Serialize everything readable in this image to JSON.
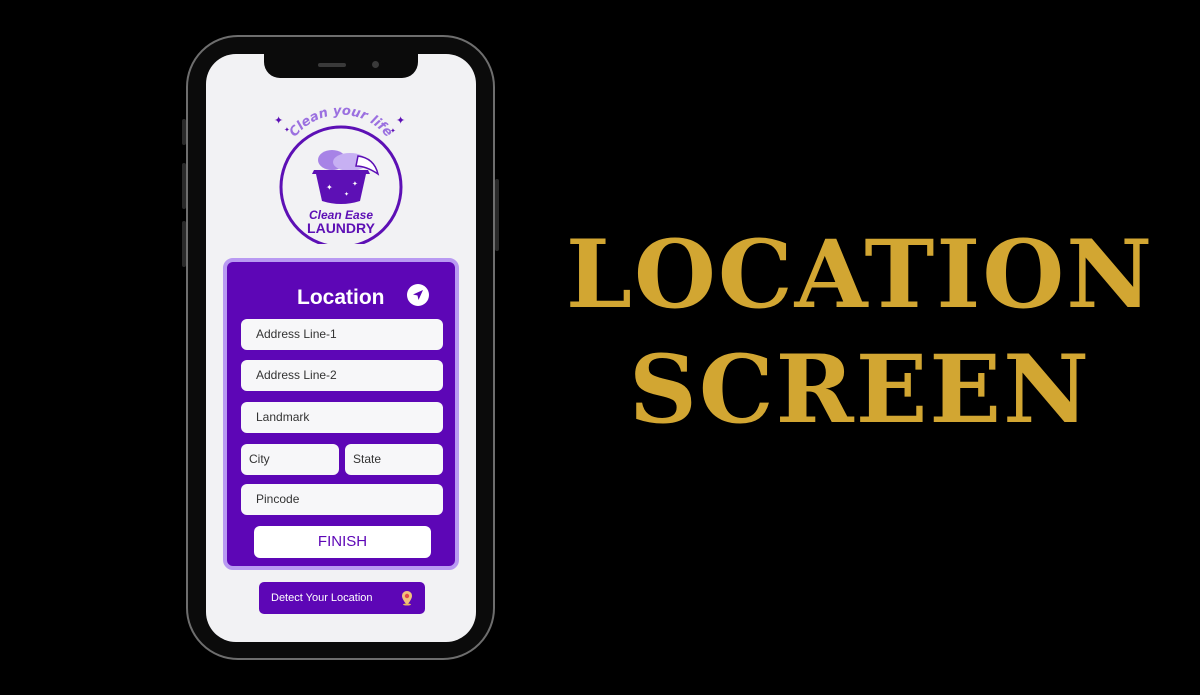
{
  "headline": {
    "line1": "LOCATION",
    "line2": "SCREEN",
    "color": "#d2a632"
  },
  "logo": {
    "top_text": "Clean your life",
    "brand_line1": "Clean Ease",
    "brand_line2": "LAUNDRY"
  },
  "card": {
    "title": "Location",
    "fields": {
      "address1": "Address Line-1",
      "address2": "Address Line-2",
      "landmark": "Landmark",
      "city": "City",
      "state": "State",
      "pincode": "Pincode"
    },
    "finish_label": "FINISH"
  },
  "detect_label": "Detect Your Location",
  "icons": {
    "title_icon": "navigation-arrow-icon",
    "detect_icon": "map-pin-icon"
  },
  "colors": {
    "primary": "#5d06b6",
    "card_border": "#b99af2",
    "screen_bg": "#f2f2f4"
  }
}
